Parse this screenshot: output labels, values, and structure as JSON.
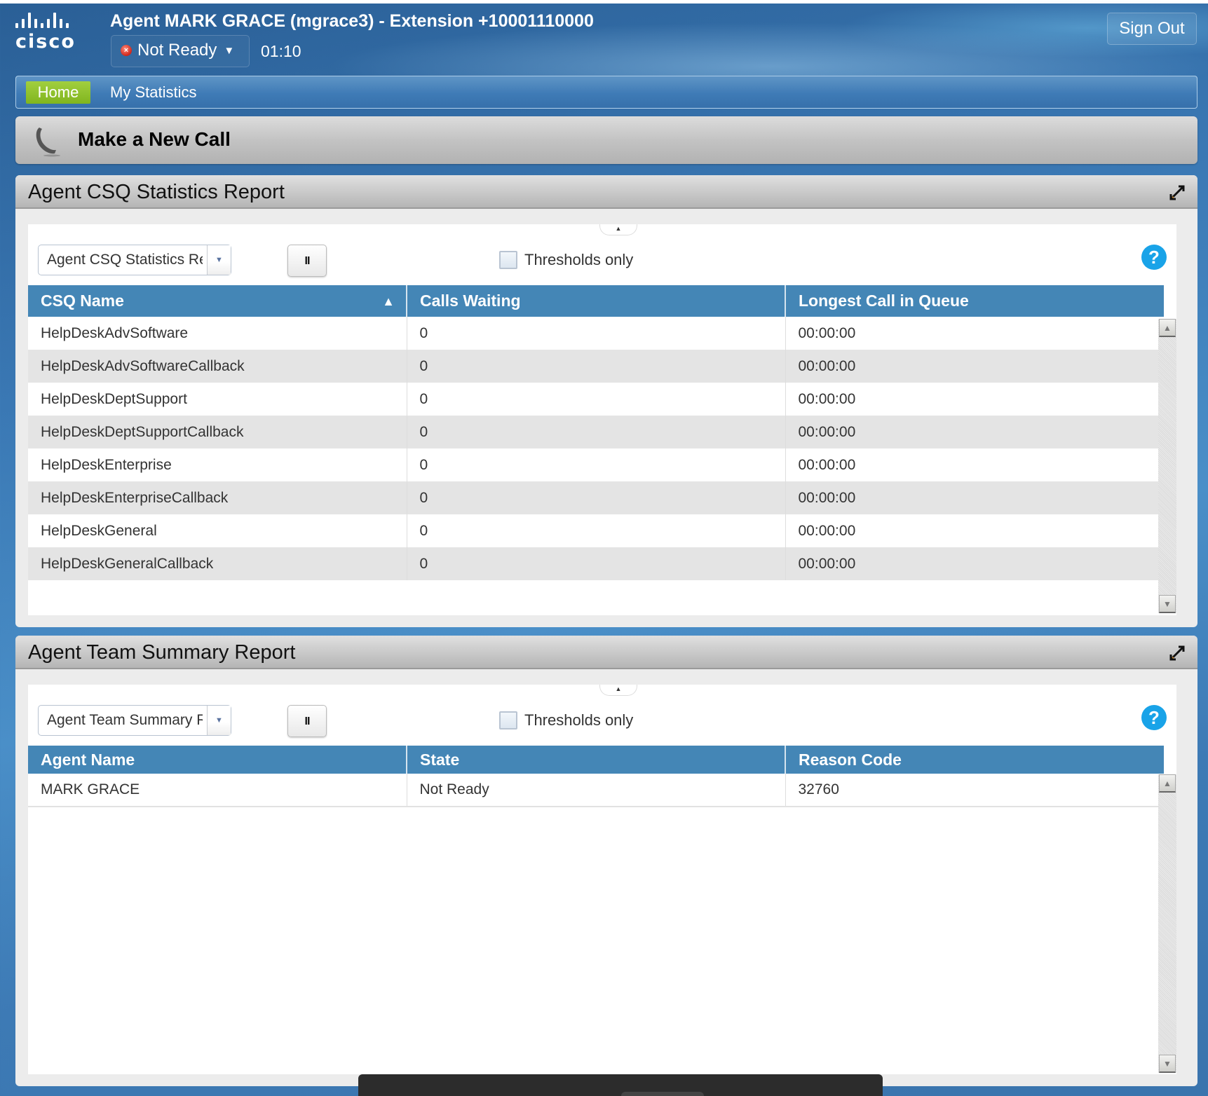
{
  "header": {
    "brand": "cisco",
    "agent_title": "Agent MARK GRACE (mgrace3) - Extension +10001110000",
    "status": {
      "label": "Not Ready",
      "icon": "not-ready-status-icon",
      "color": "#d0261a"
    },
    "timer": "01:10",
    "sign_out_label": "Sign Out"
  },
  "nav": {
    "tabs": [
      {
        "label": "Home",
        "active": true
      },
      {
        "label": "My Statistics",
        "active": false
      }
    ]
  },
  "make_call": {
    "label": "Make a New Call",
    "icon": "phone-icon"
  },
  "csq_report": {
    "title": "Agent CSQ Statistics Report",
    "select_value": "Agent CSQ Statistics Report",
    "pause_label": "II",
    "thresholds_label": "Thresholds only",
    "thresholds_checked": false,
    "help_label": "?",
    "columns": [
      "CSQ Name",
      "Calls Waiting",
      "Longest Call in Queue"
    ],
    "sort_indicator": "▲",
    "rows": [
      [
        "HelpDeskAdvSoftware",
        "0",
        "00:00:00"
      ],
      [
        "HelpDeskAdvSoftwareCallback",
        "0",
        "00:00:00"
      ],
      [
        "HelpDeskDeptSupport",
        "0",
        "00:00:00"
      ],
      [
        "HelpDeskDeptSupportCallback",
        "0",
        "00:00:00"
      ],
      [
        "HelpDeskEnterprise",
        "0",
        "00:00:00"
      ],
      [
        "HelpDeskEnterpriseCallback",
        "0",
        "00:00:00"
      ],
      [
        "HelpDeskGeneral",
        "0",
        "00:00:00"
      ],
      [
        "HelpDeskGeneralCallback",
        "0",
        "00:00:00"
      ]
    ]
  },
  "team_report": {
    "title": "Agent Team Summary Report",
    "select_value": "Agent Team Summary Report",
    "pause_label": "II",
    "thresholds_label": "Thresholds only",
    "thresholds_checked": false,
    "help_label": "?",
    "columns": [
      "Agent Name",
      "State",
      "Reason Code"
    ],
    "rows": [
      [
        "MARK GRACE",
        "Not Ready",
        "32760"
      ]
    ]
  },
  "colors": {
    "header_blue": "#3a78b4",
    "table_header": "#4486b6",
    "home_tab_green": "#8fc12a",
    "help_blue": "#19a3e8"
  }
}
